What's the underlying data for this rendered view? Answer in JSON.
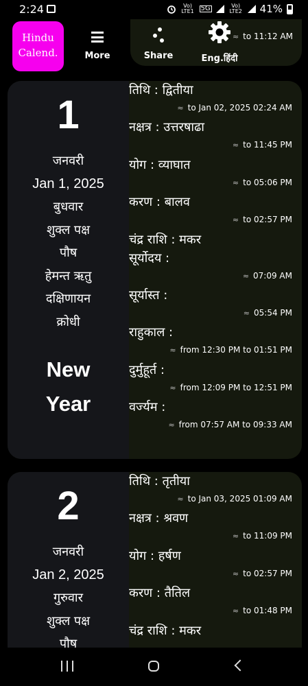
{
  "status": {
    "time": "2:24",
    "sim1": "Vo) LTE1",
    "net": "5G",
    "sim2": "Vo) LTE2",
    "battery": "41%"
  },
  "toolbar": {
    "logo_line1": "Hindu",
    "logo_line2": "Calend.",
    "more_label": "More",
    "share_label": "Share",
    "lang_label": "Eng.हिंदी",
    "top_card_text": "to 11:12 AM"
  },
  "approx_symbol": "≈",
  "days": [
    {
      "day_number": "1",
      "hindi_month": "जनवरी",
      "date": "Jan 1, 2025",
      "weekday": "बुधवार",
      "paksha": "शुक्ल पक्ष",
      "masa": "पौष",
      "ritu": "हेमन्त ऋतु",
      "ayana": "दक्षिणायन",
      "samvat": "क्रोधी",
      "festival_line1": "New",
      "festival_line2": "Year",
      "details": [
        {
          "label": "तिथि : द्वितीया",
          "time": "to Jan 02, 2025 02:24 AM"
        },
        {
          "label": "नक्षत्र : उत्तरषाढा",
          "time": "to 11:45 PM"
        },
        {
          "label": "योग : व्याघात",
          "time": "to 05:06 PM"
        },
        {
          "label": "करण : बालव",
          "time": "to 02:57 PM"
        },
        {
          "label": "चंद्र राशि : मकर",
          "time": ""
        },
        {
          "label": "सूर्योदय :",
          "time": "07:09 AM"
        },
        {
          "label": "सूर्यास्त :",
          "time": "05:54 PM"
        },
        {
          "label": "राहुकाल :",
          "time": "from 12:30 PM to 01:51 PM"
        },
        {
          "label": "दुर्मुहूर्त :",
          "time": "from 12:09 PM to 12:51 PM"
        },
        {
          "label": "वर्ज्यम :",
          "time": "from 07:57 AM to 09:33 AM"
        }
      ]
    },
    {
      "day_number": "2",
      "hindi_month": "जनवरी",
      "date": "Jan 2, 2025",
      "weekday": "गुरुवार",
      "paksha": "शुक्ल पक्ष",
      "masa": "पौष",
      "details": [
        {
          "label": "तिथि : तृतीया",
          "time": "to Jan 03, 2025 01:09 AM"
        },
        {
          "label": "नक्षत्र : श्रवण",
          "time": "to 11:09 PM"
        },
        {
          "label": "योग : हर्षण",
          "time": "to 02:57 PM"
        },
        {
          "label": "करण : तैतिल",
          "time": "to 01:48 PM"
        },
        {
          "label": "चंद्र राशि : मकर",
          "time": ""
        }
      ]
    }
  ]
}
